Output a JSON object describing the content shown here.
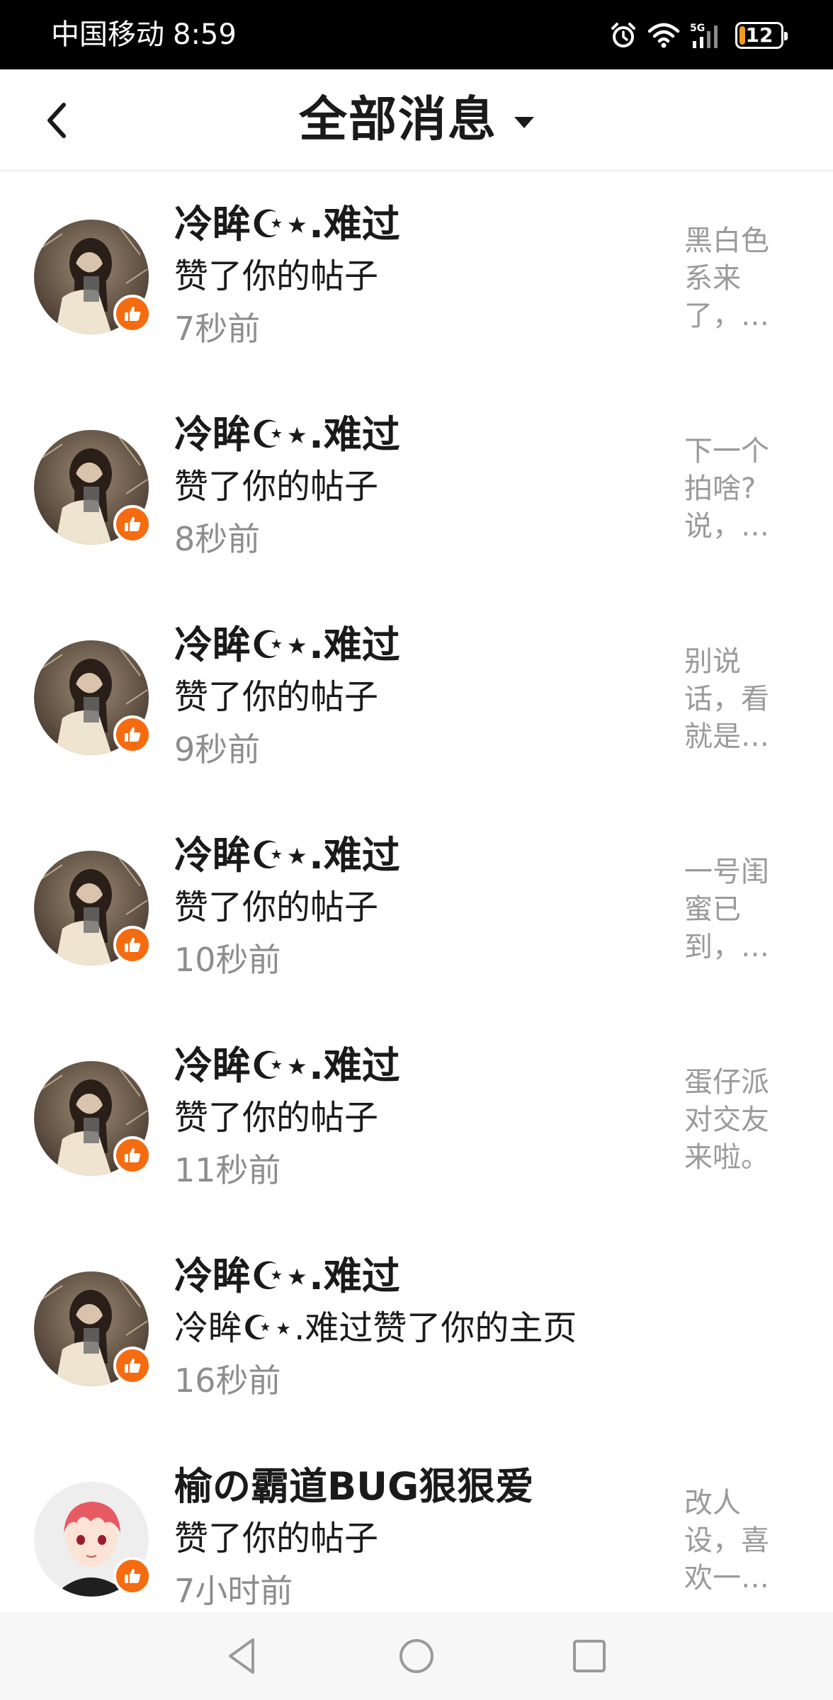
{
  "status_bar": {
    "carrier": "中国移动",
    "time": "8:59",
    "network": "5G",
    "battery_level": "12",
    "battery_color": "#f29a1f"
  },
  "header": {
    "title": "全部消息",
    "back_icon": "chevron-left-icon",
    "dropdown_icon": "caret-down-icon"
  },
  "messages": [
    {
      "username": "冷眸☪⋆.难过",
      "action": "赞了你的帖子",
      "time": "7秒前",
      "preview": "黑白色系来了，…",
      "avatar": "user-photo",
      "badge_icon": "thumbs-up-icon"
    },
    {
      "username": "冷眸☪⋆.难过",
      "action": "赞了你的帖子",
      "time": "8秒前",
      "preview": "下一个拍啥?说，…",
      "avatar": "user-photo",
      "badge_icon": "thumbs-up-icon"
    },
    {
      "username": "冷眸☪⋆.难过",
      "action": "赞了你的帖子",
      "time": "9秒前",
      "preview": "别说话，看就是…",
      "avatar": "user-photo",
      "badge_icon": "thumbs-up-icon"
    },
    {
      "username": "冷眸☪⋆.难过",
      "action": "赞了你的帖子",
      "time": "10秒前",
      "preview": "一号闺蜜已到，…",
      "avatar": "user-photo",
      "badge_icon": "thumbs-up-icon"
    },
    {
      "username": "冷眸☪⋆.难过",
      "action": "赞了你的帖子",
      "time": "11秒前",
      "preview": "蛋仔派对交友来啦。",
      "avatar": "user-photo",
      "badge_icon": "thumbs-up-icon"
    },
    {
      "username": "冷眸☪⋆.难过",
      "action": "冷眸☪⋆.难过赞了你的主页",
      "time": "16秒前",
      "preview": "",
      "avatar": "user-photo",
      "badge_icon": "thumbs-up-icon"
    },
    {
      "username": "榆の霸道BUG狠狠爱",
      "action": "赞了你的帖子",
      "time": "7小时前",
      "preview": "改人设，喜欢一…",
      "avatar": "anime-avatar",
      "badge_icon": "thumbs-up-icon"
    }
  ],
  "nav_bar": {
    "back_icon": "triangle-back-icon",
    "home_icon": "circle-home-icon",
    "recents_icon": "square-recents-icon"
  },
  "colors": {
    "accent": "#f56b10",
    "secondary_text": "#8d8d8d",
    "preview_text": "#9a9a9a"
  }
}
